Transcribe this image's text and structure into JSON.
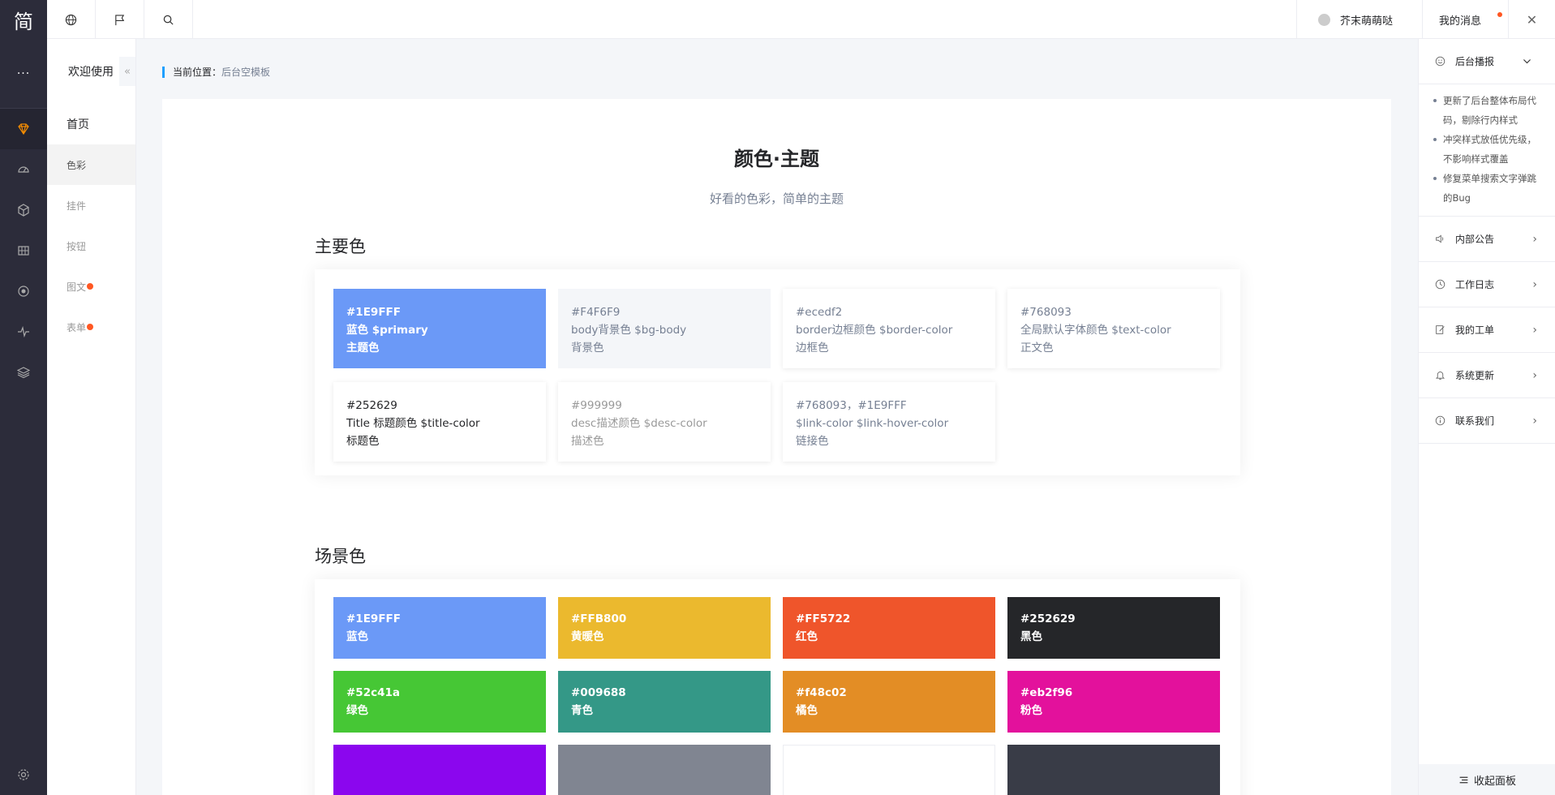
{
  "app": {
    "logo": "简",
    "more": "···"
  },
  "rail_icons": [
    "gem-icon",
    "dashboard-icon",
    "cube-icon",
    "grid-icon",
    "target-icon",
    "pulse-icon",
    "layers-icon",
    "settings-icon"
  ],
  "submenu": {
    "title": "欢迎使用",
    "collapse_icon": "«",
    "items": [
      {
        "label": "首页"
      },
      {
        "label": "色彩"
      },
      {
        "label": "挂件"
      },
      {
        "label": "按钮"
      },
      {
        "label": "图文"
      },
      {
        "label": "表单"
      }
    ]
  },
  "topbar": {
    "icons": [
      "globe-icon",
      "flag-icon",
      "search-icon"
    ],
    "user": "芥末萌萌哒",
    "messages": "我的消息",
    "close": "✕"
  },
  "breadcrumb": {
    "prefix": "当前位置：",
    "current": "后台空模板"
  },
  "page": {
    "title": "颜色·主题",
    "subtitle": "好看的色彩，简单的主题"
  },
  "primary_section": {
    "title": "主要色",
    "cards": [
      {
        "hex": "#1E9FFF",
        "desc": "蓝色 $primary",
        "name": "主题色"
      },
      {
        "hex": "#F4F6F9",
        "desc": "body背景色 $bg-body",
        "name": "背景色"
      },
      {
        "hex": "#ecedf2",
        "desc": "border边框颜色 $border-color",
        "name": "边框色"
      },
      {
        "hex": "#768093",
        "desc": "全局默认字体颜色 $text-color",
        "name": "正文色"
      },
      {
        "hex": "#252629",
        "desc": "Title 标题颜色 $title-color",
        "name": "标题色"
      },
      {
        "hex": "#999999",
        "desc": "desc描述颜色 $desc-color",
        "name": "描述色"
      },
      {
        "hex": "#768093，#1E9FFF",
        "desc": "$link-color $link-hover-color",
        "name": "链接色"
      }
    ]
  },
  "scene_section": {
    "title": "场景色",
    "swatches": [
      {
        "hex": "#1E9FFF",
        "name": "蓝色",
        "color": "#6b99f7"
      },
      {
        "hex": "#FFB800",
        "name": "黄暖色",
        "color": "#ebb92e"
      },
      {
        "hex": "#FF5722",
        "name": "红色",
        "color": "#ef552b"
      },
      {
        "hex": "#252629",
        "name": "黑色",
        "color": "#252629"
      },
      {
        "hex": "#52c41a",
        "name": "绿色",
        "color": "#46c735"
      },
      {
        "hex": "#009688",
        "name": "青色",
        "color": "#349887"
      },
      {
        "hex": "#f48c02",
        "name": "橘色",
        "color": "#e38d25"
      },
      {
        "hex": "#eb2f96",
        "name": "粉色",
        "color": "#e3119c"
      }
    ],
    "partial_row_colors": [
      "#8b06ee",
      "#808591",
      "#ffffff",
      "#393c47"
    ]
  },
  "right_panel": {
    "header": "后台播报",
    "notes": [
      "更新了后台整体布局代码，剔除行内样式",
      "冲突样式放低优先级，不影响样式覆盖",
      "修复菜单搜索文字弹跳的Bug"
    ],
    "items": [
      {
        "label": "内部公告",
        "icon": "speaker-icon"
      },
      {
        "label": "工作日志",
        "icon": "clock-icon"
      },
      {
        "label": "我的工单",
        "icon": "edit-icon"
      },
      {
        "label": "系统更新",
        "icon": "bell-icon"
      },
      {
        "label": "联系我们",
        "icon": "info-icon"
      }
    ],
    "footer": "收起面板"
  },
  "colors": {
    "accent": "#1E9FFF",
    "bg": "#F4F6F9",
    "border": "#ecedf2",
    "text": "#768093",
    "title": "#252629",
    "desc": "#999999",
    "rail": "#2c2c3a",
    "active_icon": "#f48c02"
  }
}
